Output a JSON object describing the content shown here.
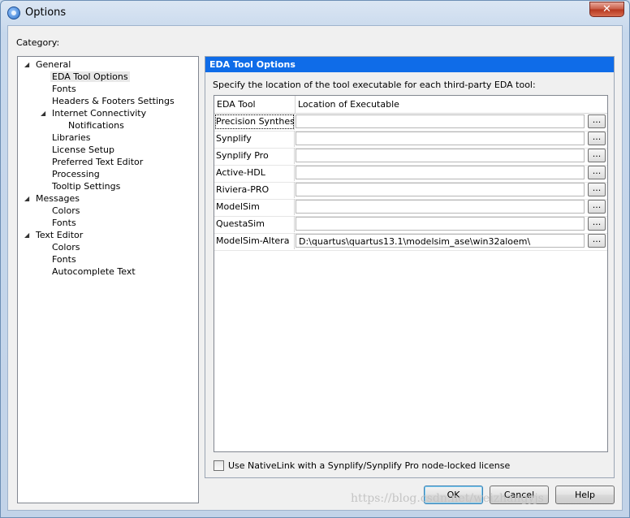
{
  "window": {
    "title": "Options",
    "close_glyph": "✕",
    "icon": "app-icon"
  },
  "category_label": "Category:",
  "tree": [
    {
      "label": "General",
      "arrow": "◢",
      "name": "tree-item-general"
    },
    {
      "label": "EDA Tool Options",
      "name": "tree-item-eda-tool-options",
      "selected": true
    },
    {
      "label": "Fonts",
      "name": "tree-item-general-fonts"
    },
    {
      "label": "Headers & Footers Settings",
      "name": "tree-item-headers-footers"
    },
    {
      "label": "Internet Connectivity",
      "arrow": "◢",
      "name": "tree-item-internet-connectivity"
    },
    {
      "label": "Notifications",
      "name": "tree-item-notifications"
    },
    {
      "label": "Libraries",
      "name": "tree-item-libraries"
    },
    {
      "label": "License Setup",
      "name": "tree-item-license-setup"
    },
    {
      "label": "Preferred Text Editor",
      "name": "tree-item-preferred-text-editor"
    },
    {
      "label": "Processing",
      "name": "tree-item-processing"
    },
    {
      "label": "Tooltip Settings",
      "name": "tree-item-tooltip-settings"
    },
    {
      "label": "Messages",
      "arrow": "◢",
      "name": "tree-item-messages"
    },
    {
      "label": "Colors",
      "name": "tree-item-messages-colors"
    },
    {
      "label": "Fonts",
      "name": "tree-item-messages-fonts"
    },
    {
      "label": "Text Editor",
      "arrow": "◢",
      "name": "tree-item-text-editor"
    },
    {
      "label": "Colors",
      "name": "tree-item-text-editor-colors"
    },
    {
      "label": "Fonts",
      "name": "tree-item-text-editor-fonts"
    },
    {
      "label": "Autocomplete Text",
      "name": "tree-item-autocomplete-text"
    }
  ],
  "panel": {
    "header": "EDA Tool Options",
    "description": "Specify the location of the tool executable for each third-party EDA tool:",
    "columns": [
      "EDA Tool",
      "Location of Executable"
    ],
    "browse_label": "...",
    "rows": [
      {
        "tool": "Precision Synthesis",
        "path": ""
      },
      {
        "tool": "Synplify",
        "path": ""
      },
      {
        "tool": "Synplify Pro",
        "path": ""
      },
      {
        "tool": "Active-HDL",
        "path": ""
      },
      {
        "tool": "Riviera-PRO",
        "path": ""
      },
      {
        "tool": "ModelSim",
        "path": ""
      },
      {
        "tool": "QuestaSim",
        "path": ""
      },
      {
        "tool": "ModelSim-Altera",
        "path": "D:\\quartus\\quartus13.1\\modelsim_ase\\win32aloem\\"
      }
    ],
    "nativelink_label": "Use NativeLink with a Synplify/Synplify Pro node-locked license",
    "nativelink_checked": false
  },
  "buttons": {
    "ok": "OK",
    "cancel": "Cancel",
    "help": "Help"
  },
  "watermark": "https://blog.csdn.net/weizhangyjs"
}
